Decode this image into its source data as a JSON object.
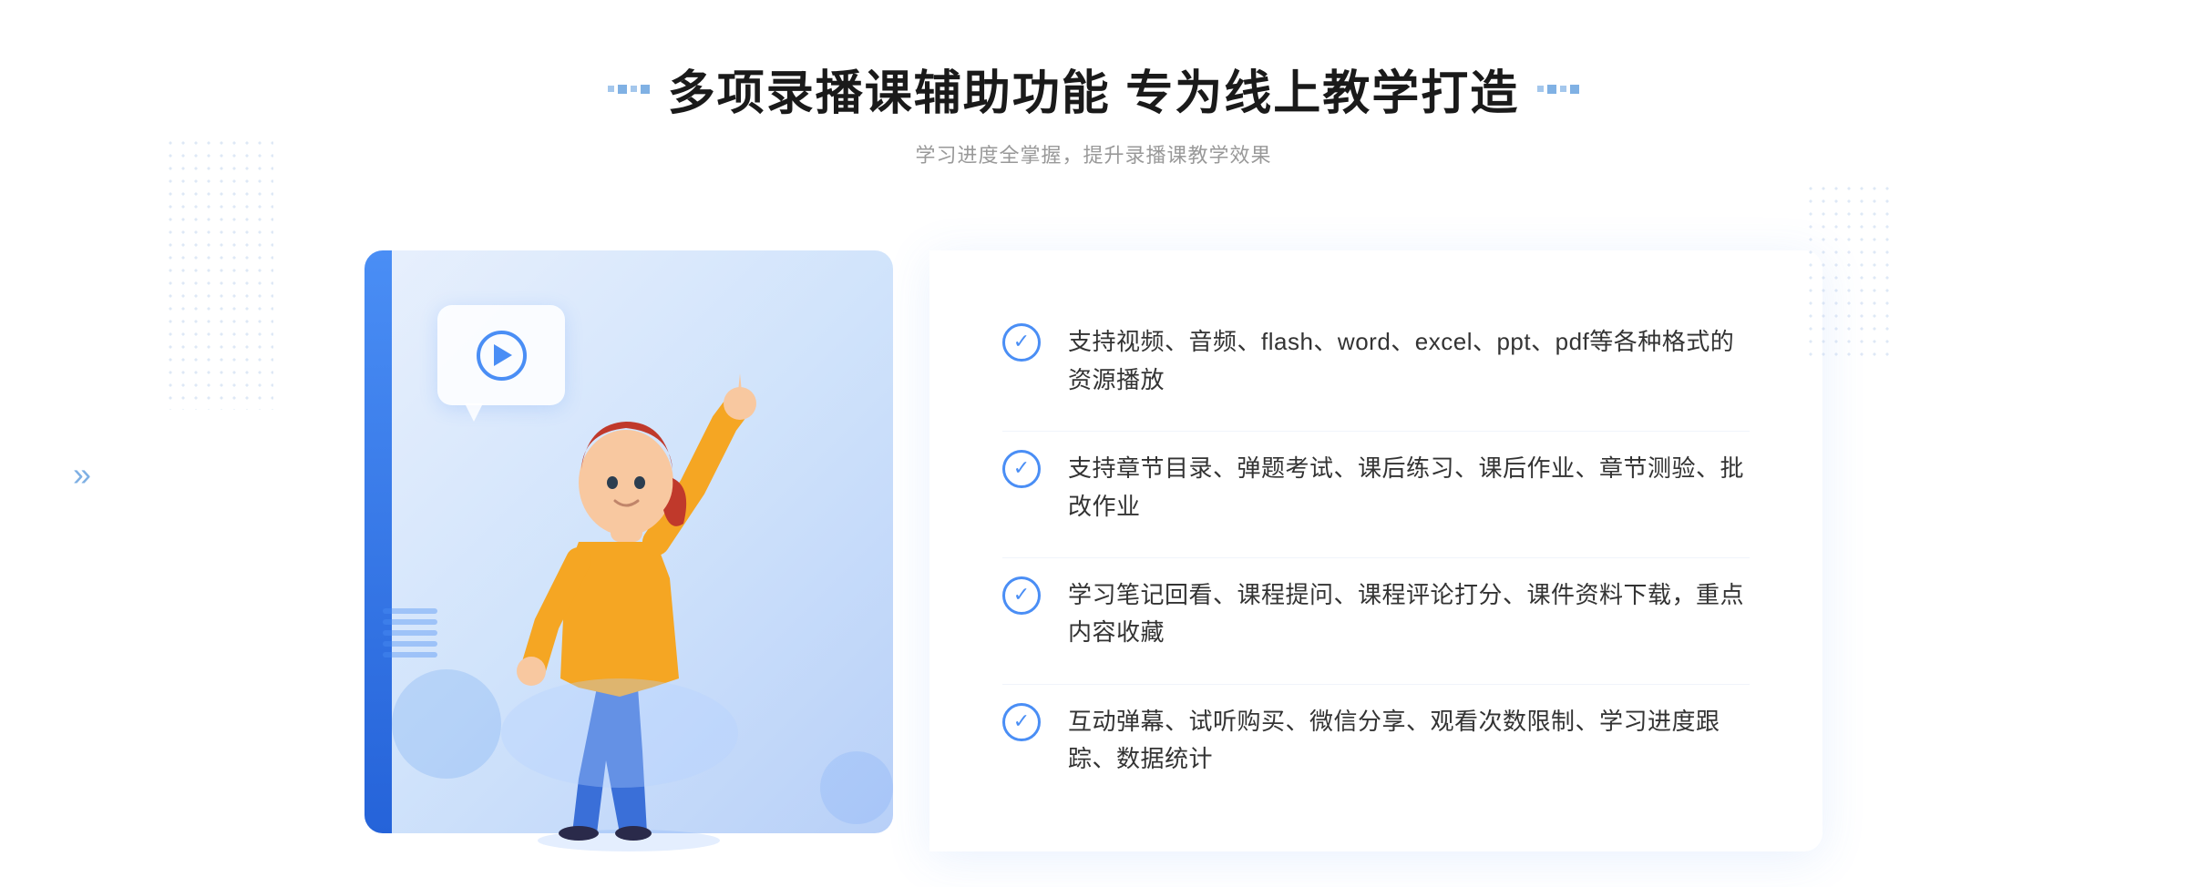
{
  "header": {
    "title": "多项录播课辅助功能 专为线上教学打造",
    "subtitle": "学习进度全掌握，提升录播课教学效果"
  },
  "features": [
    {
      "id": 1,
      "text": "支持视频、音频、flash、word、excel、ppt、pdf等各种格式的资源播放"
    },
    {
      "id": 2,
      "text": "支持章节目录、弹题考试、课后练习、课后作业、章节测验、批改作业"
    },
    {
      "id": 3,
      "text": "学习笔记回看、课程提问、课程评论打分、课件资料下载，重点内容收藏"
    },
    {
      "id": 4,
      "text": "互动弹幕、试听购买、微信分享、观看次数限制、学习进度跟踪、数据统计"
    }
  ],
  "decorations": {
    "chevron_left": "»",
    "dots_label": "decorative dots"
  }
}
